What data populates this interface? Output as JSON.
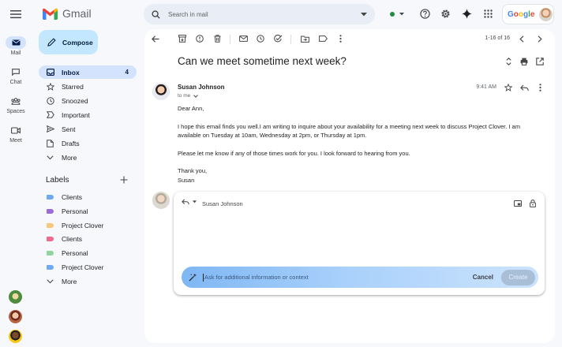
{
  "app": {
    "name": "Gmail",
    "brand_color": "#ea4335"
  },
  "header": {
    "search_placeholder": "Search in mail",
    "status_color": "#1e8e3e",
    "google_label": "Google"
  },
  "rail": [
    {
      "label": "Mail",
      "icon": "mail-icon",
      "active": true
    },
    {
      "label": "Chat",
      "icon": "chat-icon"
    },
    {
      "label": "Spaces",
      "icon": "spaces-icon"
    },
    {
      "label": "Meet",
      "icon": "meet-icon"
    }
  ],
  "compose": {
    "label": "Compose"
  },
  "nav": {
    "items": [
      {
        "label": "Inbox",
        "count": "4",
        "icon": "inbox-icon",
        "active": true
      },
      {
        "label": "Starred",
        "icon": "star-icon"
      },
      {
        "label": "Snoozed",
        "icon": "clock-icon"
      },
      {
        "label": "Important",
        "icon": "important-icon"
      },
      {
        "label": "Sent",
        "icon": "send-icon"
      },
      {
        "label": "Drafts",
        "icon": "draft-icon"
      },
      {
        "label": "More",
        "icon": "chevron-down-icon"
      }
    ]
  },
  "labels": {
    "title": "Labels",
    "items": [
      {
        "label": "Clients",
        "color": "#6fa8f5"
      },
      {
        "label": "Personal",
        "color": "#9c6ad8"
      },
      {
        "label": "Project Clover",
        "color": "#f8c77a"
      },
      {
        "label": "Clients",
        "color": "#ef6a8c"
      },
      {
        "label": "Personal",
        "color": "#8fd6a0"
      },
      {
        "label": "Project Clover",
        "color": "#6fa8f5"
      }
    ],
    "more_label": "More"
  },
  "toolbar": {
    "pagination": "1-16 of 16"
  },
  "email": {
    "subject": "Can we meet sometime next week?",
    "sender": "Susan Johnson",
    "to": "to me",
    "time": "9:41 AM",
    "greeting": "Dear Ann,",
    "body1": "I hope this email finds you well.I am writing to inquire about your availability for a meeting next week to discuss Project Clover. I am available on Tuesday at 10am, Wednesday at 2pm, or Thursday at 1pm.",
    "body2": "Please let me know if any of those times work for you. I look forward to hearing from you.",
    "signoff": "Thank you,",
    "signature": "Susan"
  },
  "reply": {
    "recipient": "Susan Johnson",
    "prompt_placeholder": "Ask for additional information or context",
    "cancel_label": "Cancel",
    "create_label": "Create"
  }
}
